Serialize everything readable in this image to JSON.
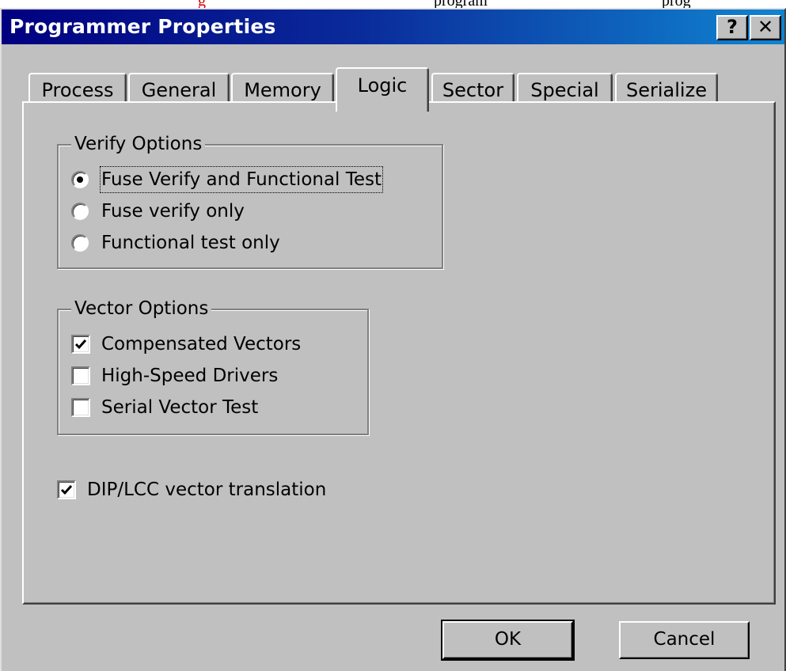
{
  "caption_fragments": {
    "red": "g",
    "black_1": "program",
    "black_2": "prog"
  },
  "window": {
    "title": "Programmer Properties",
    "help_button": "?",
    "close_button": "✕"
  },
  "tabs": [
    {
      "label": "Process",
      "active": false
    },
    {
      "label": "General",
      "active": false
    },
    {
      "label": "Memory",
      "active": false
    },
    {
      "label": "Logic",
      "active": true
    },
    {
      "label": "Sector",
      "active": false
    },
    {
      "label": "Special",
      "active": false
    },
    {
      "label": "Serialize",
      "active": false
    }
  ],
  "verify_options": {
    "title": "Verify Options",
    "options": [
      {
        "label": "Fuse Verify and Functional Test",
        "selected": true
      },
      {
        "label": "Fuse verify only",
        "selected": false
      },
      {
        "label": "Functional test only",
        "selected": false
      }
    ]
  },
  "vector_options": {
    "title": "Vector Options",
    "options": [
      {
        "label": "Compensated Vectors",
        "checked": true
      },
      {
        "label": "High-Speed Drivers",
        "checked": false
      },
      {
        "label": "Serial Vector Test",
        "checked": false
      }
    ]
  },
  "dip_lcc": {
    "label": "DIP/LCC vector translation",
    "checked": true
  },
  "buttons": {
    "ok": "OK",
    "cancel": "Cancel"
  },
  "colors": {
    "face": "#c0c0c0",
    "title_gradient_start": "#000080",
    "title_gradient_end": "#1084d0",
    "caption_red": "#d40000"
  }
}
